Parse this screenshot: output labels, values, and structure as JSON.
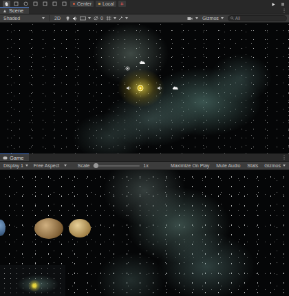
{
  "toolbar": {
    "pivot": "Center",
    "space": "Local"
  },
  "scene_tab": {
    "title": "Scene",
    "selected": true
  },
  "scene_toolbar": {
    "shading": "Shaded",
    "mode_2d": {
      "label": "2D",
      "on": false
    },
    "hidden_count": "0",
    "gizmos": "Gizmos",
    "search": {
      "placeholder": "All"
    }
  },
  "game_tab": {
    "title": "Game",
    "selected": true
  },
  "game_toolbar": {
    "display": "Display 1",
    "aspect": "Free Aspect",
    "scale": {
      "label": "Scale",
      "level": 0.02,
      "reading": "1x"
    },
    "toggles": [
      {
        "label": "Maximize On Play",
        "on": false
      },
      {
        "label": "Mute Audio",
        "on": false
      },
      {
        "label": "Stats",
        "on": false
      }
    ],
    "gizmos": "Gizmos"
  }
}
